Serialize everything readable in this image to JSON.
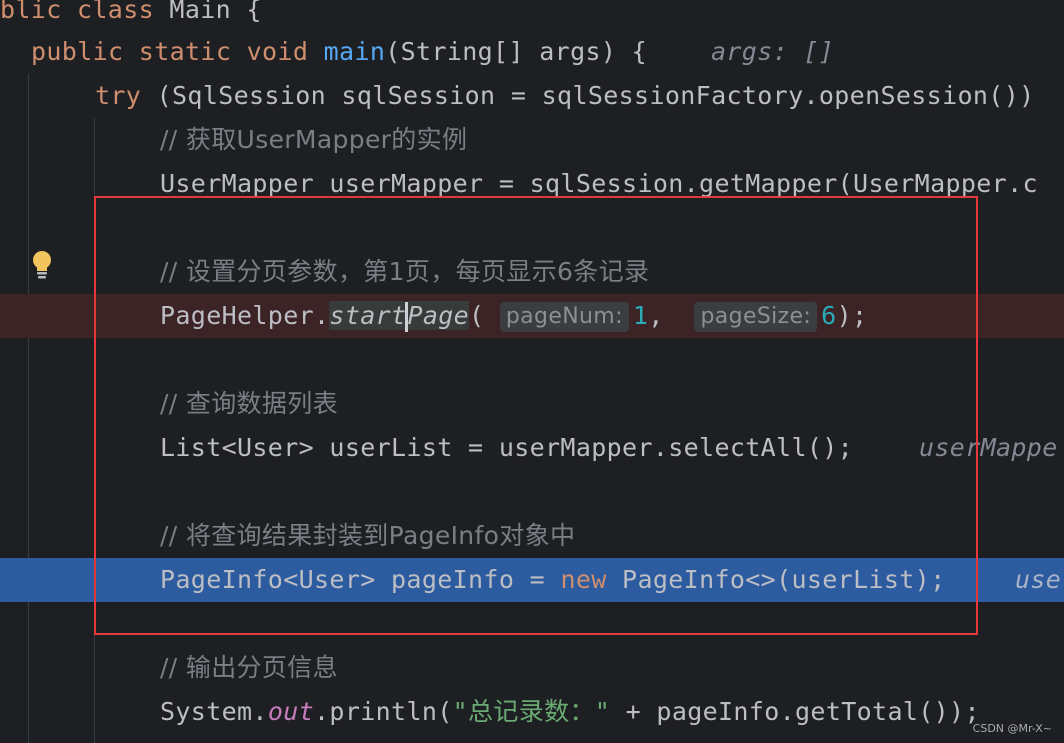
{
  "editor": {
    "lines": {
      "l0": {
        "kw": "blic class",
        "rest": " Main {"
      },
      "l1": {
        "kw": "public static void",
        "fn": "main",
        "rest": "(String[] args) {",
        "hint": "args: []"
      },
      "l2": {
        "kw": "try",
        "rest": " (SqlSession sqlSession = sqlSessionFactory.openSession())"
      },
      "l3": {
        "comment": "// 获取UserMapper的实例"
      },
      "l4": {
        "code": "UserMapper userMapper = sqlSession.getMapper(UserMapper.c"
      },
      "l6": {
        "comment": "// 设置分页参数，第1页，每页显示6条记录"
      },
      "l7": {
        "pre": "PageHelper.",
        "m1": "start",
        "m2": "Page",
        "open": "(",
        "p1": "pageNum:",
        "v1": "1",
        "comma": ",",
        "p2": "pageSize:",
        "v2": "6",
        "close": ");"
      },
      "l9": {
        "comment": "// 查询数据列表"
      },
      "l10": {
        "code": "List<User> userList = userMapper.selectAll();",
        "hint": "userMappe"
      },
      "l12": {
        "comment": "// 将查询结果封装到PageInfo对象中"
      },
      "l13": {
        "pre": "PageInfo<User> pageInfo = ",
        "kw": "new",
        "post": " PageInfo<>(userList);",
        "hint": "use"
      },
      "l15": {
        "comment": "// 输出分页信息"
      },
      "l16": {
        "pre": "System.",
        "field": "out",
        "mid": ".println(",
        "str": "\"总记录数：\"",
        "post": " + pageInfo.getTotal());"
      }
    }
  },
  "watermark": "CSDN @Mr-X~",
  "colors": {
    "background": "#1e1f22",
    "keyword": "#cf8e6d",
    "function": "#56a8f5",
    "number": "#2aacb8",
    "string": "#6aab73",
    "comment": "#7a7e85",
    "breakpoint_line": "#3b2326",
    "execution_line": "#2d5b9f",
    "annotation_box": "#e5383b"
  },
  "icons": [
    "lightbulb-icon"
  ]
}
